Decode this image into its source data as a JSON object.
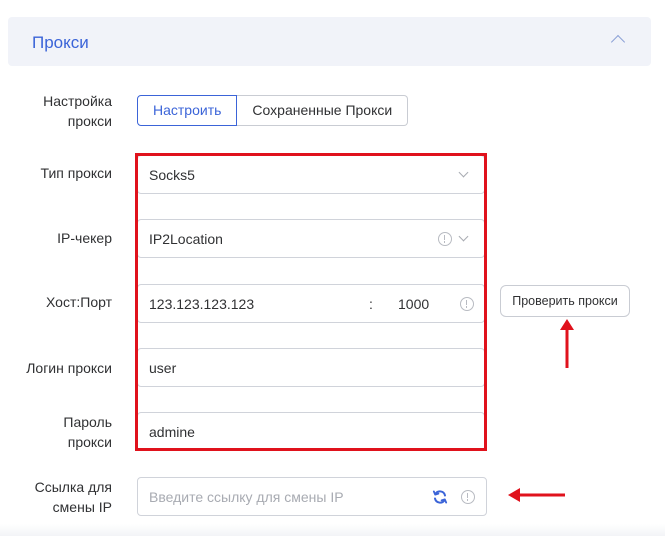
{
  "panel": {
    "title": "Прокси"
  },
  "setup": {
    "label_line1": "Настройка",
    "label_line2": "прокси",
    "tab_configure": "Настроить",
    "tab_saved": "Сохраненные Прокси"
  },
  "proxy_type": {
    "label": "Тип прокси",
    "value": "Socks5"
  },
  "ip_checker": {
    "label": "IP-чекер",
    "value": "IP2Location"
  },
  "host_port": {
    "label": "Хост:Порт",
    "host": "123.123.123.123",
    "separator": ":",
    "port": "1000"
  },
  "check_button": {
    "label": "Проверить прокси"
  },
  "login": {
    "label": "Логин прокси",
    "value": "user"
  },
  "password": {
    "label_line1": "Пароль",
    "label_line2": "прокси",
    "value": "admine"
  },
  "change_ip": {
    "label_line1": "Ссылка для",
    "label_line2": "смены IP",
    "placeholder": "Введите ссылку для смены IP"
  },
  "colors": {
    "accent": "#3b64d8",
    "highlight_red": "#e0121c",
    "border": "#d0d3da",
    "placeholder": "#a8abb2"
  },
  "icons": {
    "collapse": "chevron-up-icon",
    "dropdown": "chevron-down-icon",
    "info": "info-circle-icon",
    "refresh": "refresh-icon",
    "annotation": "red-arrow-icon"
  }
}
